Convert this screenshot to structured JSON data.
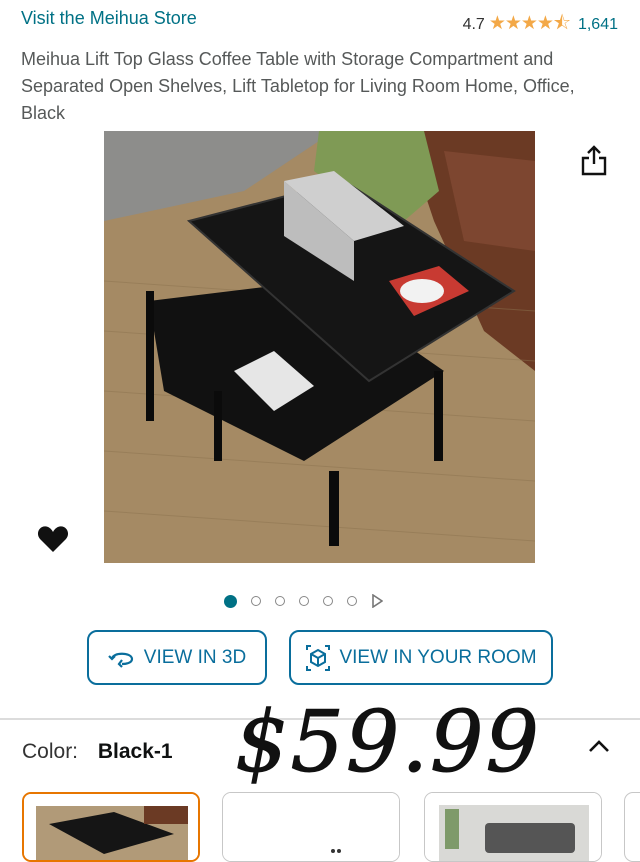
{
  "store": {
    "link_text": "Visit the Meihua Store"
  },
  "rating": {
    "value": "4.7",
    "stars": "★★★★⯪",
    "count": "1,641"
  },
  "product": {
    "title": "Meihua Lift Top Glass Coffee Table with Storage Compartment and Separated Open Shelves, Lift Tabletop for Living Room Home, Office, Black"
  },
  "carousel": {
    "total_dots": 6,
    "active_index": 0
  },
  "buttons": {
    "view_3d": "VIEW IN 3D",
    "view_room": "VIEW IN YOUR ROOM"
  },
  "variation": {
    "label": "Color:",
    "value": "Black-1"
  },
  "price": {
    "text": "$59.99"
  },
  "icons": {
    "share": "share-icon",
    "heart": "heart-icon",
    "rotate3d": "rotate-3d-icon",
    "cube": "ar-cube-icon",
    "caret": "chevron-up-icon"
  },
  "colors": {
    "link": "#007185",
    "star": "#f3a847",
    "button": "#0a6e9c",
    "selected_border": "#e77600"
  }
}
